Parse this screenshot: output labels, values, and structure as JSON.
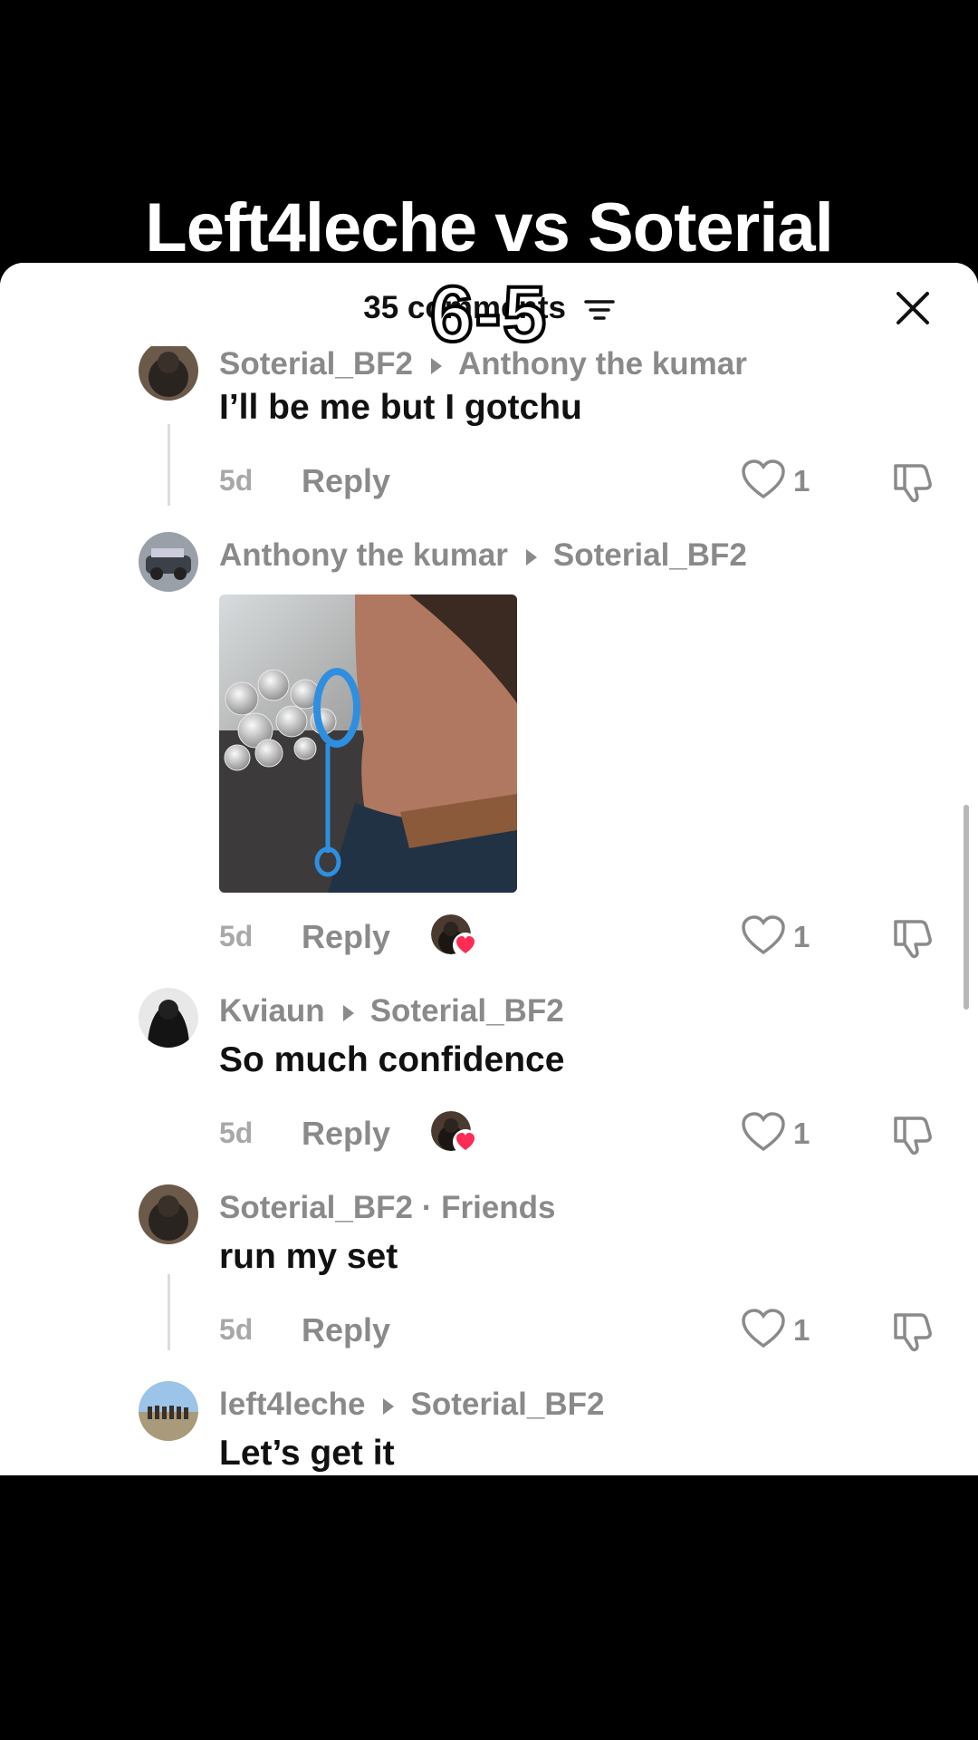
{
  "video": {
    "title": "Left4leche vs Soterial",
    "score": "6-5"
  },
  "sheet": {
    "comment_count": "35 comments",
    "filter_icon": "filter-icon",
    "close_icon": "close-icon"
  },
  "colors": {
    "heart_pink": "#fe2c55",
    "meta_gray": "#8a8a8a"
  },
  "comments": [
    {
      "author": "Soterial_BF2",
      "reply_to": "Anthony the kumar",
      "text": "I’ll be me but I gotchu",
      "time": "5d",
      "reply_label": "Reply",
      "likes": "1"
    },
    {
      "author": "Anthony the kumar",
      "reply_to": "Soterial_BF2",
      "text": "",
      "time": "5d",
      "reply_label": "Reply",
      "likes": "1",
      "media": "gif-image",
      "creator_liked": true
    },
    {
      "author": "Kviaun",
      "reply_to": "Soterial_BF2",
      "text": "So much confidence",
      "time": "5d",
      "reply_label": "Reply",
      "likes": "1",
      "creator_liked": true
    },
    {
      "author": "Soterial_BF2",
      "tag": "· Friends",
      "text": "run my set",
      "time": "5d",
      "reply_label": "Reply",
      "likes": "1"
    },
    {
      "author": "left4leche",
      "reply_to": "Soterial_BF2",
      "text": "Let’s get it"
    }
  ]
}
